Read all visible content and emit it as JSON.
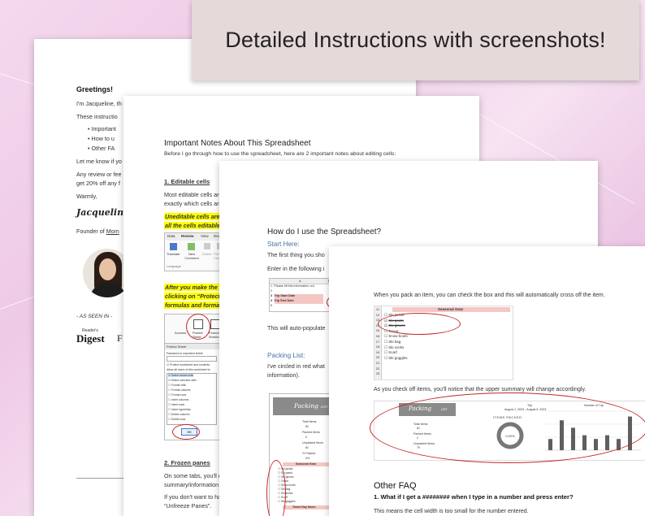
{
  "banner": {
    "title": "Detailed Instructions with screenshots!"
  },
  "page1": {
    "greeting": "Greetings!",
    "intro": "I'm Jacqueline, th",
    "these": "These instructio",
    "bullets": [
      "Important",
      "How to u",
      "Other FA"
    ],
    "let_me": "Let me know if yo",
    "review1": "Any review or fee",
    "review2": "get 20% off any f",
    "warmly": "Warmly,",
    "signature": "Jacqueline",
    "founder": "Founder of",
    "founder_link": "Mom",
    "as_seen_in": "- AS SEEN IN -",
    "logo1_top": "Reader's",
    "logo1": "Digest",
    "logo2": "F"
  },
  "page2": {
    "title": "Important Notes About This Spreadsheet",
    "lead": "Before I go through how to use the spreadsheet, here are 2 important notes about editing cells:",
    "section1": "1. Editable cells",
    "p1a": "Most editable cells are",
    "p1b": "exactly which cells are",
    "hl1a": "Uneditable cells are lo",
    "hl1b": "all the cells editable, y",
    "ribbon_tabs": [
      "Data",
      "Review",
      "View",
      "Dev"
    ],
    "ribbon_btns": [
      "Translate",
      "New Comment",
      "Delete",
      "Previous Comment"
    ],
    "ribbon_group": "Language",
    "hl2a": "After you make the ch",
    "hl2b": "clicking on “Protect Sh",
    "hl2c": "formulas and formatt",
    "protect_btns": [
      "Accessi",
      "Protect Sheet",
      "Protect Workbook"
    ],
    "dialog_title": "Protect Sheet",
    "dialog_pw": "Password to unprotect sheet:",
    "dialog_check": "Protect worksheet and contents",
    "dialog_allow": "Allow all users of this worksheet to:",
    "dialog_items": [
      "Select locked cells",
      "Select unlocked cells",
      "Format cells",
      "Format columns",
      "Format rows",
      "Insert columns",
      "Insert rows",
      "Insert hyperlinks",
      "Delete columns",
      "Delete rows"
    ],
    "dialog_ok": "OK",
    "section2": "2. Frozen panes",
    "p2a": "On some tabs, you'll n",
    "p2b": "summary/information",
    "p2c": "If you don't want to ha",
    "p2d": "“Unfreeze Panes”."
  },
  "page3": {
    "title": "How do I use the Spreadsheet?",
    "start": "Start Here:",
    "first": "The first thing you sho",
    "enter": "Enter in the following i",
    "mini_cols": [
      "A",
      "B"
    ],
    "mini_rows": [
      {
        "num": "1",
        "text": "Please fill this information out"
      },
      {
        "num": "2",
        "text": ""
      },
      {
        "num": "3",
        "text": "Trip Start Date"
      },
      {
        "num": "4",
        "text": "Trip End Date"
      },
      {
        "num": "5",
        "text": ""
      }
    ],
    "auto": "This will auto-populate",
    "packing": "Packing List:",
    "circled1": "I've circled in red what",
    "circled2": "information).",
    "list_title": "Packing",
    "list_title2": "LIST",
    "summary_labels": [
      "Total Items",
      "Packed Items",
      "Unpacked Items",
      "% Packed"
    ],
    "summary_values": [
      "81",
      "0",
      "81",
      "0%"
    ],
    "section_gear": "Seasonal Gear",
    "section_travel": "Travel Day Items",
    "gear_items": [
      "Ski jacket",
      "Ski pants",
      "Ski gloves",
      "Toque",
      "Snow boots",
      "Ski bag",
      "Ski socks",
      "Scarf",
      "Ski goggles"
    ]
  },
  "page4": {
    "intro": "When you pack an item, you can check the box and this will automatically cross off the item.",
    "sheet_title": "Seasonal Gear",
    "row_numbers": [
      "11",
      "12",
      "13",
      "14",
      "15",
      "16",
      "17",
      "18",
      "19",
      "20",
      "21",
      "22",
      "23"
    ],
    "items": [
      {
        "label": "Ski jacket",
        "checked": false,
        "crossed": false
      },
      {
        "label": "Ski pants",
        "checked": true,
        "crossed": true
      },
      {
        "label": "Ski gloves",
        "checked": true,
        "crossed": true
      },
      {
        "label": "Toque",
        "checked": false,
        "crossed": false
      },
      {
        "label": "Snow boots",
        "checked": false,
        "crossed": false
      },
      {
        "label": "Ski bag",
        "checked": false,
        "crossed": false
      },
      {
        "label": "Ski socks",
        "checked": false,
        "crossed": false
      },
      {
        "label": "Scarf",
        "checked": false,
        "crossed": false
      },
      {
        "label": "Ski goggles",
        "checked": false,
        "crossed": false
      }
    ],
    "as_check": "As you check off items, you'll notice that the upper summary will change accordingly.",
    "summary_title": "Packing",
    "summary_title2": "LIST",
    "summary_labels": [
      "Total Items",
      "Packed Items",
      "Unpacked Items"
    ],
    "summary_values": [
      "81",
      "2",
      "79"
    ],
    "trip_label": "Trip",
    "trip_dates": "August 1, 2023 - August 5, 2023",
    "items_packed_label": "ITEMS PACKED",
    "donut_text": "0.02%",
    "packed_fraction": 0.02,
    "bars_title": "Number of Trip",
    "bars_values": [
      3,
      8,
      6,
      4,
      3,
      4,
      3,
      9
    ],
    "other_faq": "Other FAQ",
    "q1": "1. What if I get a ######## when I type in a number and press enter?",
    "a1": "This means the cell width is too small for the number entered."
  },
  "colors": {
    "accent_red": "#c62828",
    "highlight": "#ffff00",
    "banner_bg": "#e6d9d9",
    "link_blue": "#4a6fa5",
    "gear_pink": "#f4c7c3"
  }
}
